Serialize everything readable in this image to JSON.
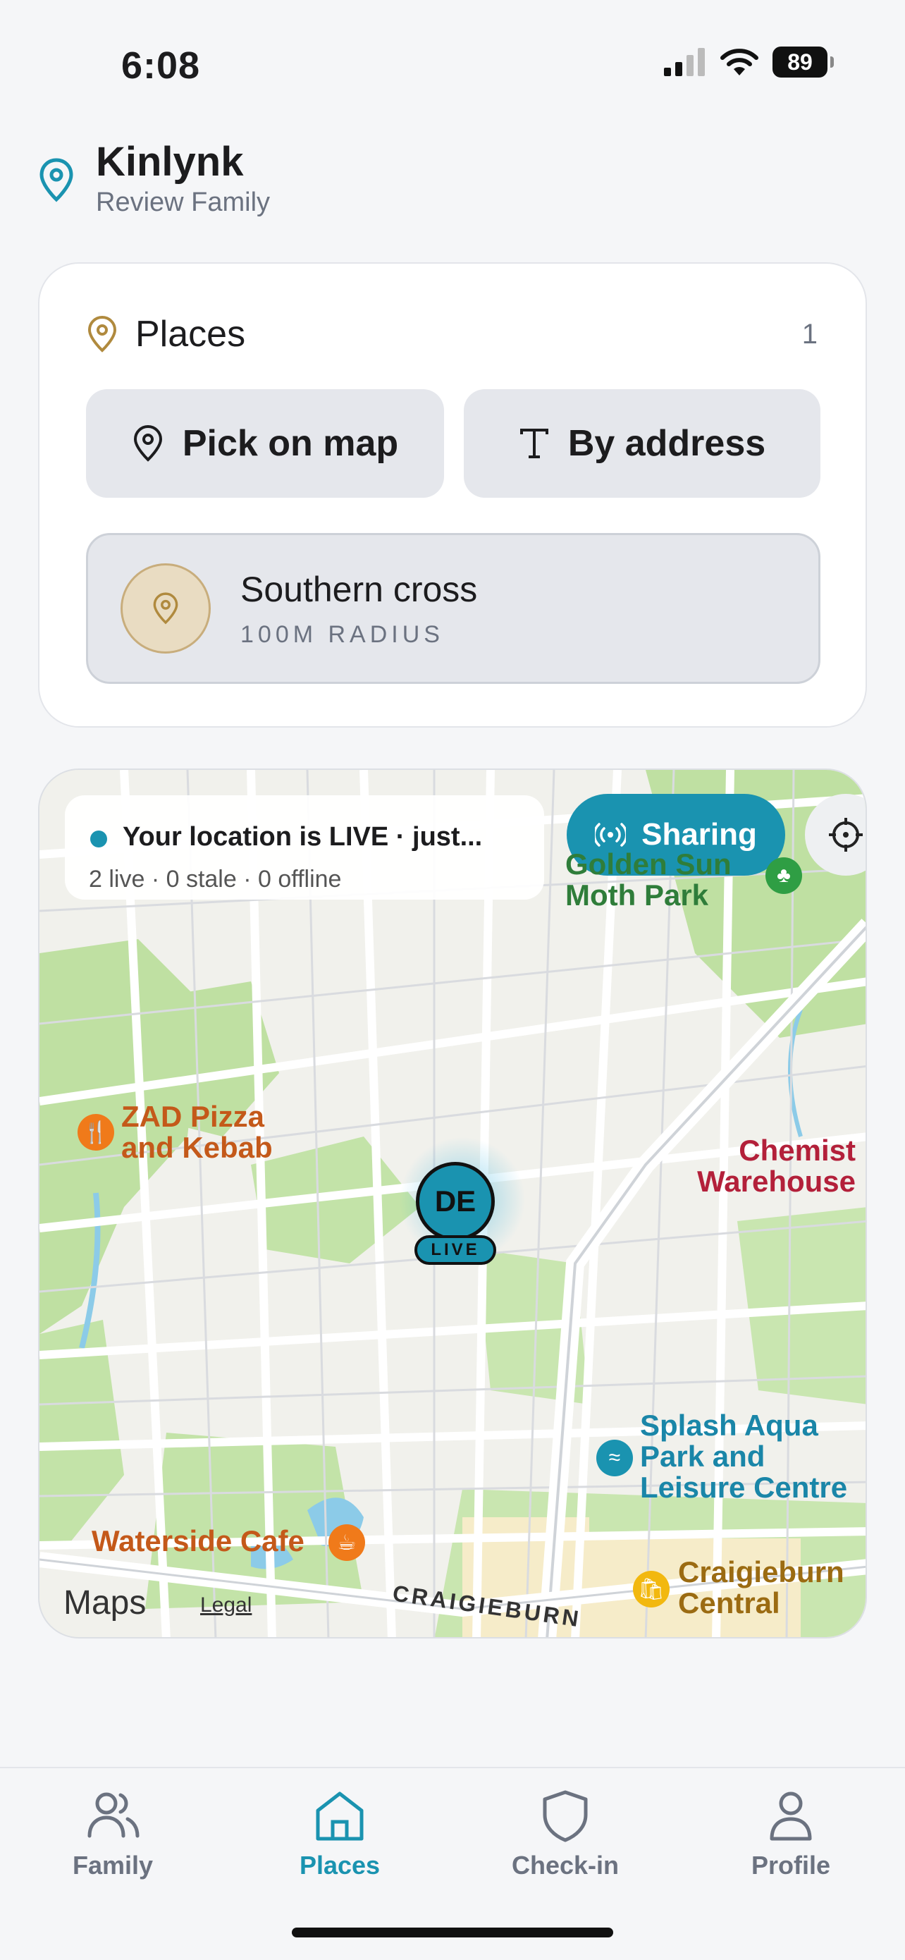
{
  "status_bar": {
    "time": "6:08",
    "battery": "89"
  },
  "header": {
    "title": "Kinlynk",
    "subtitle": "Review Family"
  },
  "places_card": {
    "title": "Places",
    "count": "1",
    "pick_on_map": "Pick on map",
    "by_address": "By address",
    "place": {
      "name": "Southern cross",
      "radius": "100M RADIUS"
    }
  },
  "map": {
    "live_status": "Your location is LIVE · just...",
    "stats": "2 live · 0 stale · 0 offline",
    "sharing_label": "Sharing",
    "avatar_initials": "DE",
    "live_badge": "LIVE",
    "pois": {
      "park": "Golden Sun Moth Park",
      "pizza_line1": "ZAD Pizza",
      "pizza_line2": "and Kebab",
      "chemist_line1": "Chemist",
      "chemist_line2": "Warehouse",
      "splash_line1": "Splash Aqua",
      "splash_line2": "Park and",
      "splash_line3": "Leisure Centre",
      "cafe": "Waterside Cafe",
      "craigieburn_line1": "Craigieburn",
      "craigieburn_line2": "Central"
    },
    "maps_brand": "Maps",
    "legal": "Legal",
    "street": "CRAIGIEBURN"
  },
  "tabs": [
    {
      "label": "Family",
      "icon": "family-icon"
    },
    {
      "label": "Places",
      "icon": "home-icon"
    },
    {
      "label": "Check-in",
      "icon": "shield-icon"
    },
    {
      "label": "Profile",
      "icon": "person-icon"
    }
  ],
  "colors": {
    "accent": "#1a93b0",
    "place_gold": "#b08a3e"
  }
}
